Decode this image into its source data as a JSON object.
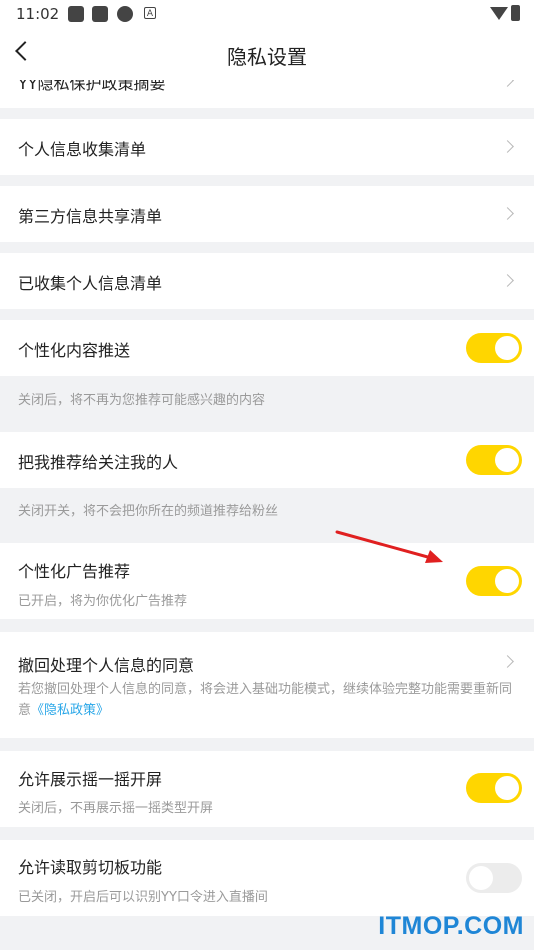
{
  "status_bar": {
    "time": "11:02"
  },
  "header": {
    "title": "隐私设置"
  },
  "items": {
    "summary": {
      "label": "YY隐私保护政策摘要"
    },
    "collect_list": {
      "label": "个人信息收集清单"
    },
    "share_list": {
      "label": "第三方信息共享清单"
    },
    "collected_list": {
      "label": "已收集个人信息清单"
    },
    "personalized_content": {
      "label": "个性化内容推送",
      "on": true,
      "note": "关闭后，将不再为您推荐可能感兴趣的内容"
    },
    "recommend_to_followers": {
      "label": "把我推荐给关注我的人",
      "on": true,
      "note": "关闭开关，将不会把你所在的频道推荐给粉丝"
    },
    "personalized_ads": {
      "label": "个性化广告推荐",
      "on": true,
      "desc": "已开启，将为你优化广告推荐"
    },
    "revoke_consent": {
      "label": "撤回处理个人信息的同意",
      "desc": "若您撤回处理个人信息的同意，将会进入基础功能模式，继续体验完整功能需要重新同意",
      "link": "《隐私政策》"
    },
    "shake_screen": {
      "label": "允许展示摇一摇开屏",
      "on": true,
      "desc": "关闭后，不再展示摇一摇类型开屏"
    },
    "clipboard": {
      "label": "允许读取剪切板功能",
      "on": false,
      "desc": "已关闭，开启后可以识别YY口令进入直播间"
    }
  },
  "colors": {
    "toggle_on": "#ffd600",
    "toggle_off": "#ececec",
    "link": "#2aa7e8",
    "annotation_arrow": "#e02020",
    "watermark": "#1f86d6"
  },
  "watermark": "ITMOP.COM"
}
